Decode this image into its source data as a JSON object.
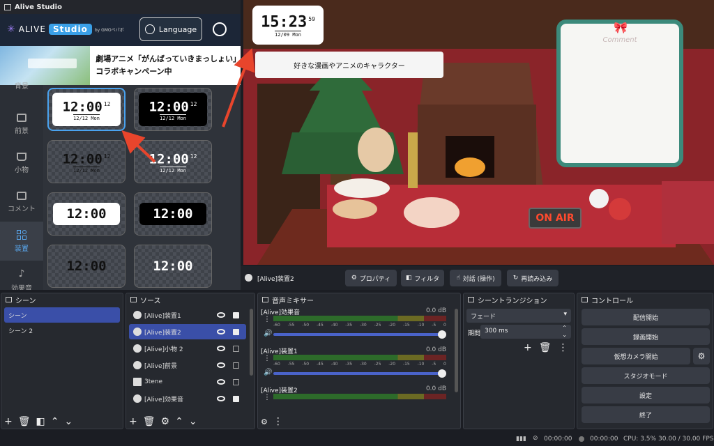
{
  "alive": {
    "window_title": "Alive Studio",
    "logo_text": "ALIVE",
    "logo_studio": "Studio",
    "logo_by": "by GMOペパボ",
    "language_label": "Language",
    "banner_text_1": "劇場アニメ「がんばっていきまっしょい」",
    "banner_text_2": "コラボキャンペーン中",
    "sidebar": [
      {
        "label": "背景",
        "icon": "background-icon"
      },
      {
        "label": "前景",
        "icon": "foreground-icon"
      },
      {
        "label": "小物",
        "icon": "cup-icon"
      },
      {
        "label": "コメント",
        "icon": "comment-icon"
      },
      {
        "label": "装置",
        "icon": "device-icon",
        "active": true
      },
      {
        "label": "効果音",
        "icon": "music-note-icon"
      }
    ],
    "tiles": [
      {
        "time": "12:00",
        "sec": "12",
        "date": "12/12 Mon",
        "style": "white",
        "selected": true
      },
      {
        "time": "12:00",
        "sec": "12",
        "date": "12/12 Mon",
        "style": "black"
      },
      {
        "time": "12:00",
        "sec": "12",
        "date": "12/12 Mon",
        "style": "clear-dark"
      },
      {
        "time": "12:00",
        "sec": "12",
        "date": "12/12 Mon",
        "style": "clear-light"
      },
      {
        "time": "12:00",
        "style": "white"
      },
      {
        "time": "12:00",
        "style": "black"
      },
      {
        "time": "12:00",
        "style": "clear-dark"
      },
      {
        "time": "12:00",
        "style": "clear-light"
      }
    ]
  },
  "preview": {
    "clock_time": "15:23",
    "clock_sec": "59",
    "clock_date": "12/09 Mon",
    "subtitle": "好きな漫画やアニメのキャラクター",
    "comment_label": "Comment",
    "onair": "ON AIR"
  },
  "toolbar": {
    "source_name": "[Alive]装置2",
    "properties": "プロパティ",
    "filters": "フィルタ",
    "interact": "対話 (操作)",
    "reload": "再読み込み"
  },
  "scenes": {
    "title": "シーン",
    "items": [
      "シーン",
      "シーン 2"
    ]
  },
  "sources": {
    "title": "ソース",
    "items": [
      {
        "name": "[Alive]装置1"
      },
      {
        "name": "[Alive]装置2",
        "selected": true
      },
      {
        "name": "[Alive]小物 2"
      },
      {
        "name": "[Alive]前景"
      },
      {
        "name": "3tene"
      },
      {
        "name": "[Alive]効果音"
      }
    ]
  },
  "mixer": {
    "title": "音声ミキサー",
    "channels": [
      {
        "name": "[Alive]効果音",
        "db": "0.0 dB"
      },
      {
        "name": "[Alive]装置1",
        "db": "0.0 dB"
      },
      {
        "name": "[Alive]装置2",
        "db": "0.0 dB"
      }
    ],
    "ticks": [
      "-60",
      "-55",
      "-50",
      "-45",
      "-40",
      "-35",
      "-30",
      "-25",
      "-20",
      "-15",
      "-10",
      "-5",
      "0"
    ]
  },
  "transitions": {
    "title": "シーントランジション",
    "type": "フェード",
    "duration_label": "期間",
    "duration": "300 ms"
  },
  "controls": {
    "title": "コントロール",
    "buttons": [
      "配信開始",
      "録画開始",
      "仮想カメラ開始",
      "スタジオモード",
      "設定",
      "終了"
    ]
  },
  "status": {
    "stream_time": "00:00:00",
    "rec_time": "00:00:00",
    "cpu": "CPU: 3.5%",
    "fps": "30.00 / 30.00 FPS"
  }
}
